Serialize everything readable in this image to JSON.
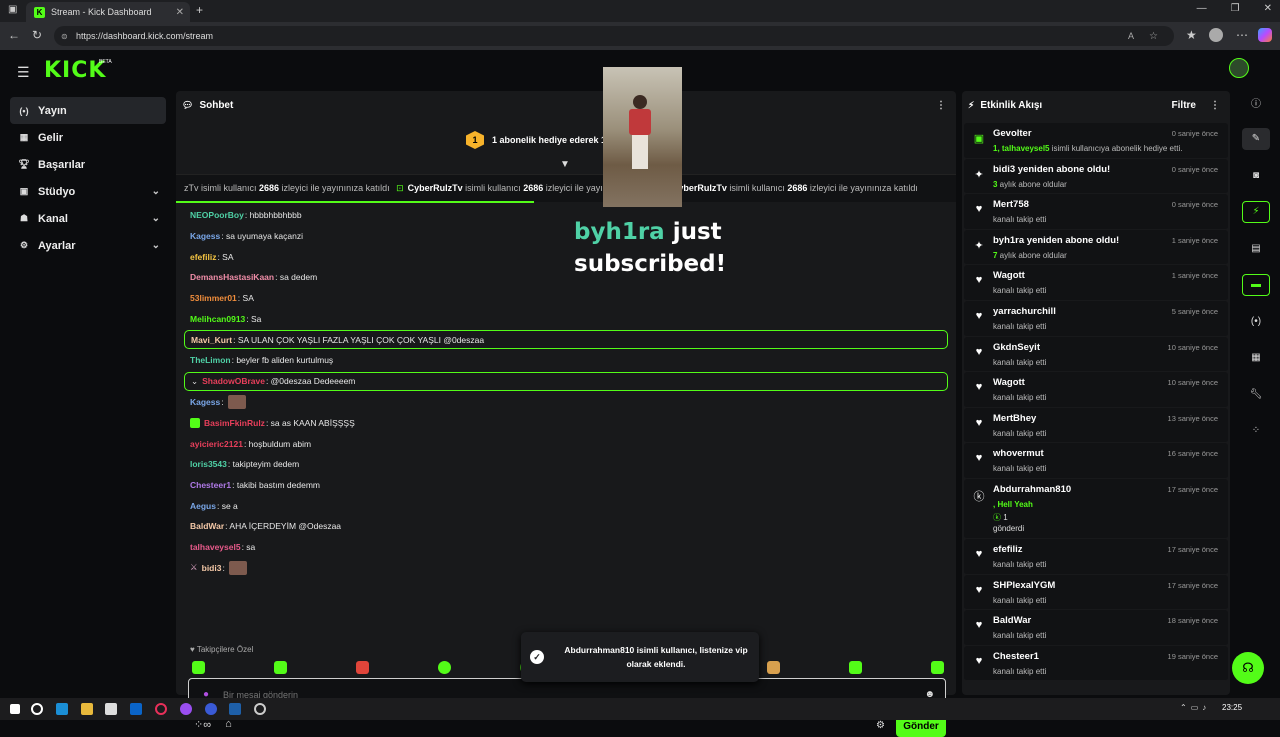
{
  "browser": {
    "tab_title": "Stream - Kick Dashboard",
    "url": "https://dashboard.kick.com/stream"
  },
  "app": {
    "logo": "KICK",
    "beta": "BETA"
  },
  "sidebar": {
    "items": [
      {
        "label": "Yayın",
        "icon": "stream-icon"
      },
      {
        "label": "Gelir",
        "icon": "revenue-icon"
      },
      {
        "label": "Başarılar",
        "icon": "trophy-icon"
      },
      {
        "label": "Stüdyo",
        "icon": "studio-icon"
      },
      {
        "label": "Kanal",
        "icon": "channel-icon"
      },
      {
        "label": "Ayarlar",
        "icon": "gear-icon"
      }
    ]
  },
  "chat": {
    "title": "Sohbet",
    "gift_banner": {
      "count": "1",
      "text": "1 abonelik hediye ederek 1."
    },
    "ticker": {
      "prefix": "zTv isimli kullanıcı ",
      "count": "2686",
      "mid": " izleyici ile yayınınıza katıldı",
      "user": "CyberRulzTv",
      "suffix": " isimli kullanıcı "
    },
    "messages": [
      {
        "user": "NEOPoorBoy",
        "color": "#4fd1a6",
        "text": ": hbbbhbbhbbb"
      },
      {
        "user": "Kagess",
        "color": "#7aa7e8",
        "text": ": sa uyumaya kaçanzi"
      },
      {
        "user": "efefiliz",
        "color": "#f5c542",
        "text": ": SA"
      },
      {
        "user": "DemansHastasiKaan",
        "color": "#f08da8",
        "text": ": sa dedem"
      },
      {
        "user": "53limmer01",
        "color": "#f08d3c",
        "text": ": SA"
      },
      {
        "user": "Melihcan0913",
        "color": "#53fc18",
        "text": ": Sa"
      },
      {
        "user": "Mavi_Kurt",
        "color": "#f5c9a8",
        "text": ": SA ULAN ÇOK YAŞLI FAZLA YAŞLI ÇOK ÇOK YAŞLI @0deszaa",
        "hl": true
      },
      {
        "user": "TheLimon",
        "color": "#4fd1a6",
        "text": ": beyler fb aliden kurtulmuş"
      },
      {
        "user": "ShadowOBrave",
        "color": "#e83f5b",
        "text": ": @0deszaa Dedeeeem",
        "hl": true
      },
      {
        "user": "Kagess",
        "color": "#7aa7e8",
        "text": ":"
      },
      {
        "user": "BasimFkinRulz",
        "color": "#e83f5b",
        "text": ": sa as KAAN ABİŞŞŞŞ"
      },
      {
        "user": "ayicieric2121",
        "color": "#e83f5b",
        "text": ": hoşbuldum abim"
      },
      {
        "user": "loris3543",
        "color": "#4fd1a6",
        "text": ": takipteyim dedem"
      },
      {
        "user": "Chesteer1",
        "color": "#b07ae8",
        "text": ": takibi bastım dedemm"
      },
      {
        "user": "Aegus",
        "color": "#7aa7e8",
        "text": ": se a"
      },
      {
        "user": "BaldWar",
        "color": "#f5c9a8",
        "text": ": AHA İÇERDEYİM @Odeszaa"
      },
      {
        "user": "talhaveysel5",
        "color": "#e85a8b",
        "text": ": sa"
      },
      {
        "user": "bidi3",
        "color": "#f5c9a8",
        "text": ":"
      }
    ],
    "follow_only": "Takipçilere Özel",
    "input_placeholder": "Bir mesaj gönderin",
    "send_label": "Gönder"
  },
  "overlay": {
    "sub_name": "byh1ra",
    "sub_text": " just subscribed!",
    "toast": "Abdurrahman810 isimli kullanıcı, listenize vip olarak eklendi."
  },
  "activity": {
    "title": "Etkinlik Akışı",
    "filter_label": "Filtre",
    "items": [
      {
        "icon": "gift-icon",
        "name": "Gevolter",
        "sub_hl": "1, talhaveysel5",
        "sub": " isimli kullanıcıya abonelik hediye etti.",
        "time": "0 saniye önce"
      },
      {
        "icon": "sparkle-icon",
        "name": "bidi3 yeniden abone oldu!",
        "sub_hl": "3",
        "sub": " aylık abone oldular",
        "time": "0 saniye önce"
      },
      {
        "icon": "heart-icon",
        "name": "Mert758",
        "sub_hl": "",
        "sub": "kanalı takip etti",
        "time": "0 saniye önce"
      },
      {
        "icon": "sparkle-icon",
        "name": "byh1ra yeniden abone oldu!",
        "sub_hl": "7",
        "sub": " aylık abone oldular",
        "time": "1 saniye önce"
      },
      {
        "icon": "heart-icon",
        "name": "Wagott",
        "sub_hl": "",
        "sub": "kanalı takip etti",
        "time": "1 saniye önce"
      },
      {
        "icon": "heart-icon",
        "name": "yarrachurchill",
        "sub_hl": "",
        "sub": "kanalı takip etti",
        "time": "5 saniye önce"
      },
      {
        "icon": "heart-icon",
        "name": "GkdnSeyit",
        "sub_hl": "",
        "sub": "kanalı takip etti",
        "time": "10 saniye önce"
      },
      {
        "icon": "heart-icon",
        "name": "Wagott",
        "sub_hl": "",
        "sub": "kanalı takip etti",
        "time": "10 saniye önce"
      },
      {
        "icon": "heart-icon",
        "name": "MertBhey",
        "sub_hl": "",
        "sub": "kanalı takip etti",
        "time": "13 saniye önce"
      },
      {
        "icon": "heart-icon",
        "name": "whovermut",
        "sub_hl": "",
        "sub": "kanalı takip etti",
        "time": "16 saniye önce"
      },
      {
        "icon": "kick-icon",
        "name": "Abdurrahman810",
        "sub_hl": ", Hell Yeah",
        "sub": "",
        "amount": "1",
        "sent": "gönderdi",
        "time": "17 saniye önce",
        "tall": true
      },
      {
        "icon": "heart-icon",
        "name": "efefiliz",
        "sub_hl": "",
        "sub": "kanalı takip etti",
        "time": "17 saniye önce"
      },
      {
        "icon": "heart-icon",
        "name": "SHPlexalYGM",
        "sub_hl": "",
        "sub": "kanalı takip etti",
        "time": "17 saniye önce"
      },
      {
        "icon": "heart-icon",
        "name": "BaldWar",
        "sub_hl": "",
        "sub": "kanalı takip etti",
        "time": "18 saniye önce"
      },
      {
        "icon": "heart-icon",
        "name": "Chesteer1",
        "sub_hl": "",
        "sub": "kanalı takip etti",
        "time": "19 saniye önce"
      }
    ]
  },
  "taskbar": {
    "time": "23:25"
  },
  "colors": {
    "accent": "#53fc18",
    "panel": "#18191b",
    "background": "#0b0c0e"
  }
}
